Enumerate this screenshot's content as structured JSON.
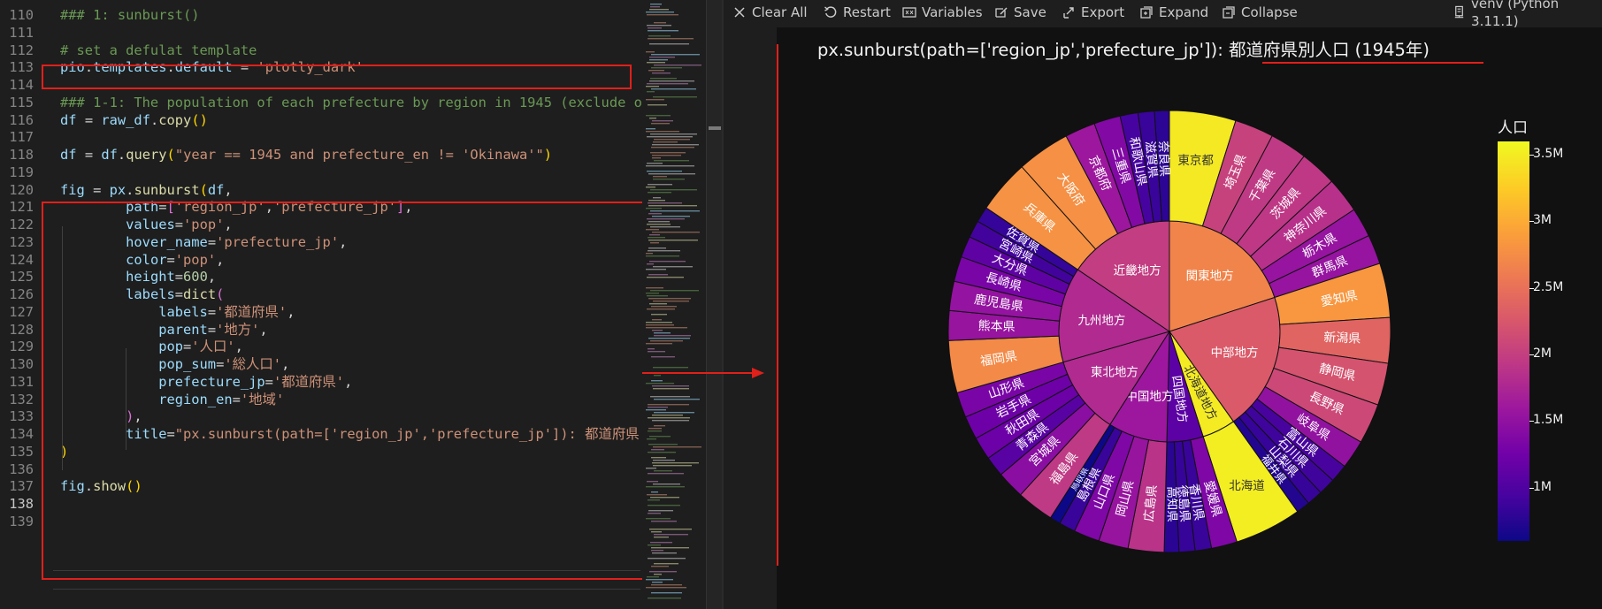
{
  "editor": {
    "lines": [
      {
        "n": "110",
        "tokens": [
          [
            "c-cm",
            "### 1: sunburst()"
          ]
        ]
      },
      {
        "n": "111",
        "tokens": []
      },
      {
        "n": "112",
        "tokens": [
          [
            "c-cm",
            "# set a defulat template"
          ]
        ]
      },
      {
        "n": "113",
        "tokens": [
          [
            "c-var",
            "pio"
          ],
          [
            "c-op",
            "."
          ],
          [
            "c-var",
            "templates"
          ],
          [
            "c-op",
            "."
          ],
          [
            "c-var",
            "default"
          ],
          [
            "c-op",
            " = "
          ],
          [
            "c-str",
            "'plotly_dark'"
          ]
        ]
      },
      {
        "n": "114",
        "tokens": []
      },
      {
        "n": "115",
        "tokens": [
          [
            "c-cm",
            "### 1-1: The population of each prefecture by region in 1945 (exclude o"
          ]
        ]
      },
      {
        "n": "116",
        "tokens": [
          [
            "c-var",
            "df"
          ],
          [
            "c-op",
            " = "
          ],
          [
            "c-var",
            "raw_df"
          ],
          [
            "c-op",
            "."
          ],
          [
            "c-fn",
            "copy"
          ],
          [
            "c-par",
            "()"
          ]
        ]
      },
      {
        "n": "117",
        "tokens": []
      },
      {
        "n": "118",
        "tokens": [
          [
            "c-var",
            "df"
          ],
          [
            "c-op",
            " = "
          ],
          [
            "c-var",
            "df"
          ],
          [
            "c-op",
            "."
          ],
          [
            "c-fn",
            "query"
          ],
          [
            "c-par",
            "("
          ],
          [
            "c-str",
            "\"year == 1945 and prefecture_en != 'Okinawa'\""
          ],
          [
            "c-par",
            ")"
          ]
        ]
      },
      {
        "n": "119",
        "tokens": []
      },
      {
        "n": "120",
        "tokens": [
          [
            "c-var",
            "fig"
          ],
          [
            "c-op",
            " = "
          ],
          [
            "c-var",
            "px"
          ],
          [
            "c-op",
            "."
          ],
          [
            "c-fn",
            "sunburst"
          ],
          [
            "c-par",
            "("
          ],
          [
            "c-var",
            "df"
          ],
          [
            "c-op",
            ","
          ]
        ]
      },
      {
        "n": "121",
        "tokens": [
          [
            "c-op",
            "        "
          ],
          [
            "c-var",
            "path"
          ],
          [
            "c-op",
            "="
          ],
          [
            "c-par2",
            "["
          ],
          [
            "c-str",
            "'region_jp'"
          ],
          [
            "c-op",
            ","
          ],
          [
            "c-str",
            "'prefecture_jp'"
          ],
          [
            "c-par2",
            "]"
          ],
          [
            "c-op",
            ","
          ]
        ]
      },
      {
        "n": "122",
        "tokens": [
          [
            "c-op",
            "        "
          ],
          [
            "c-var",
            "values"
          ],
          [
            "c-op",
            "="
          ],
          [
            "c-str",
            "'pop'"
          ],
          [
            "c-op",
            ","
          ]
        ]
      },
      {
        "n": "123",
        "tokens": [
          [
            "c-op",
            "        "
          ],
          [
            "c-var",
            "hover_name"
          ],
          [
            "c-op",
            "="
          ],
          [
            "c-str",
            "'prefecture_jp'"
          ],
          [
            "c-op",
            ","
          ]
        ]
      },
      {
        "n": "124",
        "tokens": [
          [
            "c-op",
            "        "
          ],
          [
            "c-var",
            "color"
          ],
          [
            "c-op",
            "="
          ],
          [
            "c-str",
            "'pop'"
          ],
          [
            "c-op",
            ","
          ]
        ]
      },
      {
        "n": "125",
        "tokens": [
          [
            "c-op",
            "        "
          ],
          [
            "c-var",
            "height"
          ],
          [
            "c-op",
            "="
          ],
          [
            "c-num",
            "600"
          ],
          [
            "c-op",
            ","
          ]
        ]
      },
      {
        "n": "126",
        "tokens": [
          [
            "c-op",
            "        "
          ],
          [
            "c-var",
            "labels"
          ],
          [
            "c-op",
            "="
          ],
          [
            "c-fn",
            "dict"
          ],
          [
            "c-par2",
            "("
          ]
        ]
      },
      {
        "n": "127",
        "tokens": [
          [
            "c-op",
            "            "
          ],
          [
            "c-var",
            "labels"
          ],
          [
            "c-op",
            "="
          ],
          [
            "c-str",
            "'都道府県'"
          ],
          [
            "c-op",
            ","
          ]
        ]
      },
      {
        "n": "128",
        "tokens": [
          [
            "c-op",
            "            "
          ],
          [
            "c-var",
            "parent"
          ],
          [
            "c-op",
            "="
          ],
          [
            "c-str",
            "'地方'"
          ],
          [
            "c-op",
            ","
          ]
        ]
      },
      {
        "n": "129",
        "tokens": [
          [
            "c-op",
            "            "
          ],
          [
            "c-var",
            "pop"
          ],
          [
            "c-op",
            "="
          ],
          [
            "c-str",
            "'人口'"
          ],
          [
            "c-op",
            ","
          ]
        ]
      },
      {
        "n": "130",
        "tokens": [
          [
            "c-op",
            "            "
          ],
          [
            "c-var",
            "pop_sum"
          ],
          [
            "c-op",
            "="
          ],
          [
            "c-str",
            "'総人口'"
          ],
          [
            "c-op",
            ","
          ]
        ]
      },
      {
        "n": "131",
        "tokens": [
          [
            "c-op",
            "            "
          ],
          [
            "c-var",
            "prefecture_jp"
          ],
          [
            "c-op",
            "="
          ],
          [
            "c-str",
            "'都道府県'"
          ],
          [
            "c-op",
            ","
          ]
        ]
      },
      {
        "n": "132",
        "tokens": [
          [
            "c-op",
            "            "
          ],
          [
            "c-var",
            "region_en"
          ],
          [
            "c-op",
            "="
          ],
          [
            "c-str",
            "'地域'"
          ]
        ]
      },
      {
        "n": "133",
        "tokens": [
          [
            "c-op",
            "        "
          ],
          [
            "c-par2",
            ")"
          ],
          [
            "c-op",
            ","
          ]
        ]
      },
      {
        "n": "134",
        "tokens": [
          [
            "c-op",
            "        "
          ],
          [
            "c-var",
            "title"
          ],
          [
            "c-op",
            "="
          ],
          [
            "c-str",
            "\"px.sunburst(path=['region_jp','prefecture_jp']): 都道府県"
          ]
        ]
      },
      {
        "n": "135",
        "tokens": [
          [
            "c-par",
            ")"
          ]
        ]
      },
      {
        "n": "136",
        "tokens": []
      },
      {
        "n": "137",
        "tokens": [
          [
            "c-var",
            "fig"
          ],
          [
            "c-op",
            "."
          ],
          [
            "c-fn",
            "show"
          ],
          [
            "c-par",
            "()"
          ]
        ]
      },
      {
        "n": "138",
        "tokens": []
      },
      {
        "n": "139",
        "tokens": []
      }
    ]
  },
  "toolbar": {
    "clear_all": "Clear All",
    "restart": "Restart",
    "variables": "Variables",
    "save": "Save",
    "export": "Export",
    "expand": "Expand",
    "collapse": "Collapse",
    "kernel": "venv (Python 3.11.1)"
  },
  "figure": {
    "title": "px.sunburst(path=['region_jp','prefecture_jp']): 都道府県別人口 (1945年)",
    "colorbar_title": "人口",
    "colorbar_ticks": [
      {
        "label": "3.5M",
        "value": 3.5
      },
      {
        "label": "3M",
        "value": 3.0
      },
      {
        "label": "2.5M",
        "value": 2.5
      },
      {
        "label": "2M",
        "value": 2.0
      },
      {
        "label": "1.5M",
        "value": 1.5
      },
      {
        "label": "1M",
        "value": 1.0
      }
    ],
    "colorbar_range": [
      0.6,
      3.6
    ],
    "colors": {
      "c0": "#0d0887",
      "c1": "#46039f",
      "c2": "#7201a8",
      "c3": "#9c179e",
      "c4": "#bd3786",
      "c5": "#d8576b",
      "c6": "#ed7953",
      "c7": "#fb9f3a",
      "c8": "#fdca26",
      "c9": "#f0f921"
    }
  },
  "chart_data": {
    "type": "sunburst",
    "title": "px.sunburst(path=['region_jp','prefecture_jp']): 都道府県別人口 (1945年)",
    "regions": [
      {
        "name": "関東地方",
        "color": 2.7,
        "children": [
          {
            "name": "東京都",
            "value": 3.49
          },
          {
            "name": "埼玉県",
            "value": 2.05
          },
          {
            "name": "千葉県",
            "value": 1.96
          },
          {
            "name": "茨城県",
            "value": 1.94
          },
          {
            "name": "神奈川県",
            "value": 1.87
          },
          {
            "name": "栃木県",
            "value": 1.55
          },
          {
            "name": "群馬県",
            "value": 1.55
          }
        ]
      },
      {
        "name": "中部地方",
        "color": 2.3,
        "children": [
          {
            "name": "愛知県",
            "value": 2.86
          },
          {
            "name": "新潟県",
            "value": 2.39
          },
          {
            "name": "静岡県",
            "value": 2.22
          },
          {
            "name": "長野県",
            "value": 2.12
          },
          {
            "name": "岐阜県",
            "value": 1.52
          },
          {
            "name": "富山県",
            "value": 0.95
          },
          {
            "name": "石川県",
            "value": 0.89
          },
          {
            "name": "山梨県",
            "value": 0.84
          },
          {
            "name": "福井県",
            "value": 0.72
          }
        ]
      },
      {
        "name": "北海道地方",
        "color": 3.5,
        "children": [
          {
            "name": "北海道",
            "value": 3.52
          }
        ]
      },
      {
        "name": "四国地方",
        "color": 1.1,
        "children": [
          {
            "name": "愛媛県",
            "value": 1.36
          },
          {
            "name": "香川県",
            "value": 0.86
          },
          {
            "name": "徳島県",
            "value": 0.84
          },
          {
            "name": "高知県",
            "value": 0.77
          }
        ]
      },
      {
        "name": "中国地方",
        "color": 1.6,
        "children": [
          {
            "name": "広島県",
            "value": 1.89
          },
          {
            "name": "岡山県",
            "value": 1.56
          },
          {
            "name": "山口県",
            "value": 1.36
          },
          {
            "name": "島根県",
            "value": 0.86
          },
          {
            "name": "鳥取県",
            "value": 0.56
          }
        ]
      },
      {
        "name": "東北地方",
        "color": 1.8,
        "children": [
          {
            "name": "福島県",
            "value": 1.96
          },
          {
            "name": "宮城県",
            "value": 1.46
          },
          {
            "name": "青森県",
            "value": 1.08
          },
          {
            "name": "秋田県",
            "value": 1.21
          },
          {
            "name": "岩手県",
            "value": 1.23
          },
          {
            "name": "山形県",
            "value": 1.33
          }
        ]
      },
      {
        "name": "九州地方",
        "color": 1.8,
        "children": [
          {
            "name": "福岡県",
            "value": 2.75
          },
          {
            "name": "熊本県",
            "value": 1.56
          },
          {
            "name": "鹿児島県",
            "value": 1.54
          },
          {
            "name": "長崎県",
            "value": 1.32
          },
          {
            "name": "大分県",
            "value": 1.12
          },
          {
            "name": "宮崎県",
            "value": 0.91
          },
          {
            "name": "佐賀県",
            "value": 0.83
          }
        ]
      },
      {
        "name": "近畿地方",
        "color": 2.0,
        "children": [
          {
            "name": "兵庫県",
            "value": 2.82
          },
          {
            "name": "大阪府",
            "value": 2.8
          },
          {
            "name": "京都府",
            "value": 1.6
          },
          {
            "name": "三重県",
            "value": 1.39
          },
          {
            "name": "和歌山県",
            "value": 0.94
          },
          {
            "name": "滋賀県",
            "value": 0.86
          },
          {
            "name": "奈良県",
            "value": 0.78
          }
        ]
      }
    ]
  }
}
